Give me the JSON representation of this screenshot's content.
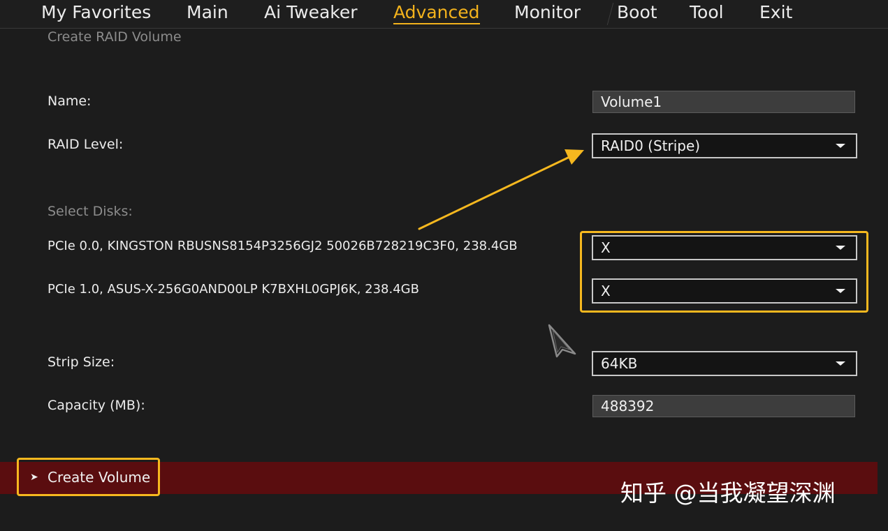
{
  "menu": {
    "tabs": [
      {
        "label": "My Favorites"
      },
      {
        "label": "Main"
      },
      {
        "label": "Ai Tweaker"
      },
      {
        "label": "Advanced"
      },
      {
        "label": "Monitor"
      },
      {
        "label": "Boot"
      },
      {
        "label": "Tool"
      },
      {
        "label": "Exit"
      }
    ],
    "active": "Advanced"
  },
  "page": {
    "section_title": "Create RAID Volume"
  },
  "form": {
    "name_label": "Name:",
    "name_value": "Volume1",
    "raid_level_label": "RAID Level:",
    "raid_level_value": "RAID0 (Stripe)",
    "select_disks_label": "Select Disks:",
    "disks": [
      {
        "label": "PCIe 0.0, KINGSTON RBUSNS8154P3256GJ2 50026B728219C3F0, 238.4GB",
        "value": "X"
      },
      {
        "label": "PCIe 1.0, ASUS-X-256G0AND00LP K7BXHL0GPJ6K, 238.4GB",
        "value": "X"
      }
    ],
    "strip_size_label": "Strip Size:",
    "strip_size_value": "64KB",
    "capacity_label": "Capacity (MB):",
    "capacity_value": "488392"
  },
  "actions": {
    "create_volume_label": "Create Volume"
  },
  "watermark": {
    "text": "知乎 @当我凝望深渊"
  },
  "colors": {
    "accent": "#f6b81f",
    "active_tab": "#f3b21c",
    "background": "#1c1c1c",
    "action_bar": "#5a0d0f"
  },
  "icons": {
    "dropdown": "chevron-down-icon",
    "pointer": "mouse-cursor-icon",
    "callout": "annotation-arrow",
    "create_chevron": "chevron-right-icon"
  }
}
